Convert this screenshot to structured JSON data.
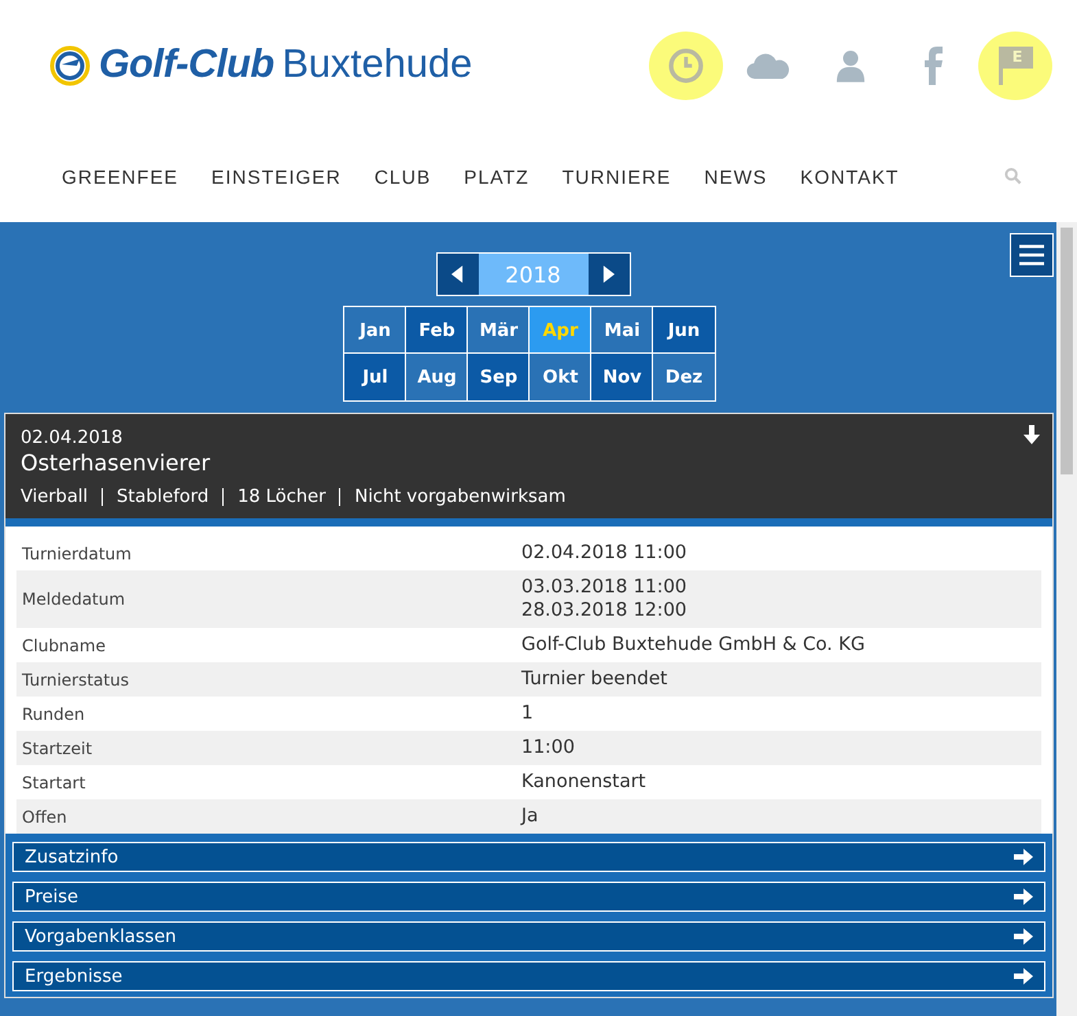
{
  "logo": {
    "bold": "Golf-Club",
    "rest": "Buxtehude"
  },
  "header_icons": [
    {
      "kind": "clock",
      "highlighted": true
    },
    {
      "kind": "cloud",
      "highlighted": false
    },
    {
      "kind": "user",
      "highlighted": false
    },
    {
      "kind": "facebook",
      "highlighted": false
    },
    {
      "kind": "flag",
      "highlighted": true,
      "label": "E"
    }
  ],
  "nav": [
    "GREENFEE",
    "EINSTEIGER",
    "CLUB",
    "PLATZ",
    "TURNIERE",
    "NEWS",
    "KONTAKT"
  ],
  "year": "2018",
  "months": [
    {
      "label": "Jan",
      "selected": false
    },
    {
      "label": "Feb",
      "selected": false
    },
    {
      "label": "Mär",
      "selected": false
    },
    {
      "label": "Apr",
      "selected": true
    },
    {
      "label": "Mai",
      "selected": false
    },
    {
      "label": "Jun",
      "selected": false
    },
    {
      "label": "Jul",
      "selected": false
    },
    {
      "label": "Aug",
      "selected": false
    },
    {
      "label": "Sep",
      "selected": false
    },
    {
      "label": "Okt",
      "selected": false
    },
    {
      "label": "Nov",
      "selected": false
    },
    {
      "label": "Dez",
      "selected": false
    }
  ],
  "tournament": {
    "date": "02.04.2018",
    "name": "Osterhasenvierer",
    "tags": [
      "Vierball",
      "Stableford",
      "18 Löcher",
      "Nicht vorgabenwirksam"
    ],
    "details": [
      {
        "label": "Turnierdatum",
        "values": [
          "02.04.2018 11:00"
        ]
      },
      {
        "label": "Meldedatum",
        "values": [
          "03.03.2018 11:00",
          "28.03.2018 12:00"
        ]
      },
      {
        "label": "Clubname",
        "values": [
          "Golf-Club Buxtehude GmbH & Co. KG"
        ]
      },
      {
        "label": "Turnierstatus",
        "values": [
          "Turnier beendet"
        ]
      },
      {
        "label": "Runden",
        "values": [
          "1"
        ]
      },
      {
        "label": "Startzeit",
        "values": [
          "11:00"
        ]
      },
      {
        "label": "Startart",
        "values": [
          "Kanonenstart"
        ]
      },
      {
        "label": "Offen",
        "values": [
          "Ja"
        ]
      }
    ],
    "sections": [
      "Zusatzinfo",
      "Preise",
      "Vorgabenklassen",
      "Ergebnisse"
    ]
  }
}
